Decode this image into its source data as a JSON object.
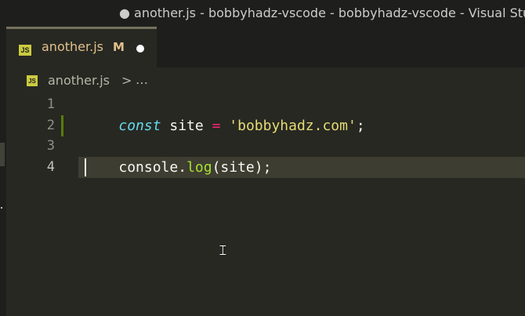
{
  "window": {
    "title": "● another.js - bobbyhadz-vscode - bobbyhadz-vscode - Visual Studio Code"
  },
  "tab": {
    "icon": "javascript-file-icon",
    "icon_text": "JS",
    "label": "another.js",
    "status": "M",
    "dirty_indicator": "unsaved-changes-dot"
  },
  "breadcrumb": {
    "icon": "javascript-file-icon",
    "icon_text": "JS",
    "file": "another.js",
    "separator": ">",
    "more": "…"
  },
  "editor": {
    "lines": [
      {
        "number": "1",
        "tokens": [
          {
            "text": "const",
            "kind": "keyword"
          },
          {
            "text": " site ",
            "kind": "plain"
          },
          {
            "text": "=",
            "kind": "operator"
          },
          {
            "text": " ",
            "kind": "plain"
          },
          {
            "text": "'bobbyhadz.com'",
            "kind": "string"
          },
          {
            "text": ";",
            "kind": "plain"
          }
        ]
      },
      {
        "number": "2",
        "tokens": []
      },
      {
        "number": "3",
        "tokens": [
          {
            "text": "console",
            "kind": "plain"
          },
          {
            "text": ".",
            "kind": "plain"
          },
          {
            "text": "log",
            "kind": "func"
          },
          {
            "text": "(",
            "kind": "paren"
          },
          {
            "text": "site",
            "kind": "plain"
          },
          {
            "text": ")",
            "kind": "paren"
          },
          {
            "text": ";",
            "kind": "plain"
          }
        ]
      },
      {
        "number": "4",
        "tokens": []
      }
    ],
    "active_line": "4",
    "git_added_line": "2"
  },
  "colors": {
    "background": "#272822",
    "keyword": "#66d9ef",
    "operator": "#f92672",
    "string": "#e6db74",
    "function": "#a6e22e",
    "modified": "#e2c08d",
    "git_added": "#587c0c",
    "js_icon": "#cbcb41"
  }
}
